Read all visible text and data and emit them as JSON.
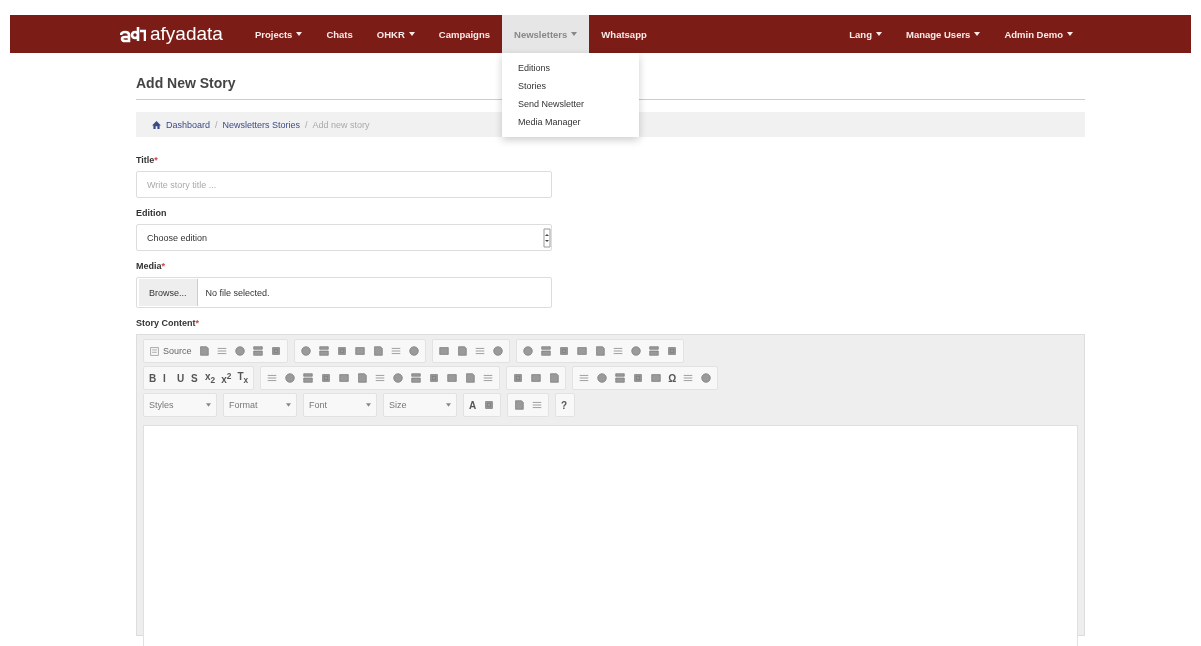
{
  "navbar": {
    "brand": "afyadata",
    "items": [
      {
        "label": "Projects",
        "dropdown": true,
        "selected": false
      },
      {
        "label": "Chats",
        "dropdown": false,
        "selected": false
      },
      {
        "label": "OHKR",
        "dropdown": true,
        "selected": false
      },
      {
        "label": "Campaigns",
        "dropdown": false,
        "selected": false
      },
      {
        "label": "Newsletters",
        "dropdown": true,
        "selected": true
      },
      {
        "label": "Whatsapp",
        "dropdown": false,
        "selected": false
      }
    ],
    "right_items": [
      {
        "label": "Lang",
        "dropdown": true
      },
      {
        "label": "Manage Users",
        "dropdown": true
      },
      {
        "label": "Admin Demo",
        "dropdown": true
      }
    ],
    "open_menu": [
      "Editions",
      "Stories",
      "Send Newsletter",
      "Media Manager"
    ]
  },
  "page_title": "Add New Story",
  "breadcrumb": [
    {
      "label": "Dashboard",
      "link": true
    },
    {
      "separator": "/",
      "label": "Newsletters Stories",
      "link": true
    },
    {
      "separator": "/",
      "label": "Add new story",
      "link": false
    }
  ],
  "form": {
    "fields": [
      {
        "kind": "text",
        "label": "Title",
        "required_mark": "*",
        "placeholder": "Write story title ..."
      },
      {
        "kind": "select",
        "label": "Edition",
        "value": "Choose edition"
      },
      {
        "kind": "file",
        "label": "Media",
        "required_mark": "*",
        "button": "Browse...",
        "value": "No file selected."
      }
    ],
    "editor": {
      "label": "Story Content",
      "required_mark": "*",
      "toolbar": [
        [
          [
            {
              "kind": "button",
              "text": "Source"
            },
            {
              "kind": "icon"
            },
            {
              "kind": "icon"
            },
            {
              "kind": "icon"
            },
            {
              "kind": "icon"
            },
            {
              "kind": "icon"
            }
          ],
          [
            {
              "kind": "icon"
            },
            {
              "kind": "icon"
            },
            {
              "kind": "icon"
            },
            {
              "kind": "icon"
            },
            {
              "kind": "icon"
            },
            {
              "kind": "icon"
            },
            {
              "kind": "icon"
            }
          ],
          [
            {
              "kind": "icon"
            },
            {
              "kind": "icon"
            },
            {
              "kind": "icon"
            },
            {
              "kind": "icon"
            }
          ],
          [
            {
              "kind": "icon"
            },
            {
              "kind": "icon"
            },
            {
              "kind": "icon"
            },
            {
              "kind": "icon"
            },
            {
              "kind": "icon"
            },
            {
              "kind": "icon"
            },
            {
              "kind": "icon"
            },
            {
              "kind": "icon"
            },
            {
              "kind": "icon"
            }
          ]
        ],
        [
          [
            {
              "kind": "glyph",
              "text": "B"
            },
            {
              "kind": "glyph",
              "text": "I"
            },
            {
              "kind": "glyph",
              "text": "U"
            },
            {
              "kind": "glyph",
              "text": "S"
            },
            {
              "kind": "glyph",
              "text": "x$_{2}$"
            },
            {
              "kind": "glyph",
              "text": "x$^{2}$"
            },
            {
              "kind": "glyph",
              "text": "T$_{x}$"
            }
          ],
          [
            {
              "kind": "icon"
            },
            {
              "kind": "icon"
            },
            {
              "kind": "icon"
            },
            {
              "kind": "icon"
            },
            {
              "kind": "icon"
            },
            {
              "kind": "icon"
            },
            {
              "kind": "icon"
            },
            {
              "kind": "icon"
            },
            {
              "kind": "icon"
            },
            {
              "kind": "icon"
            },
            {
              "kind": "icon"
            },
            {
              "kind": "icon"
            },
            {
              "kind": "icon"
            }
          ],
          [
            {
              "kind": "icon"
            },
            {
              "kind": "icon"
            },
            {
              "kind": "icon"
            }
          ],
          [
            {
              "kind": "icon"
            },
            {
              "kind": "icon"
            },
            {
              "kind": "icon"
            },
            {
              "kind": "icon"
            },
            {
              "kind": "icon"
            },
            {
              "kind": "glyph",
              "text": "Ω"
            },
            {
              "kind": "icon"
            },
            {
              "kind": "icon"
            }
          ]
        ],
        [
          [
            {
              "kind": "combo",
              "text": "Styles"
            }
          ],
          [
            {
              "kind": "combo",
              "text": "Format"
            }
          ],
          [
            {
              "kind": "combo",
              "text": "Font"
            }
          ],
          [
            {
              "kind": "combo",
              "text": "Size"
            }
          ],
          [
            {
              "kind": "glyph",
              "text": "A"
            },
            {
              "kind": "icon"
            }
          ],
          [
            {
              "kind": "icon"
            },
            {
              "kind": "icon"
            }
          ],
          [
            {
              "kind": "glyph",
              "text": "?"
            }
          ]
        ]
      ]
    }
  }
}
